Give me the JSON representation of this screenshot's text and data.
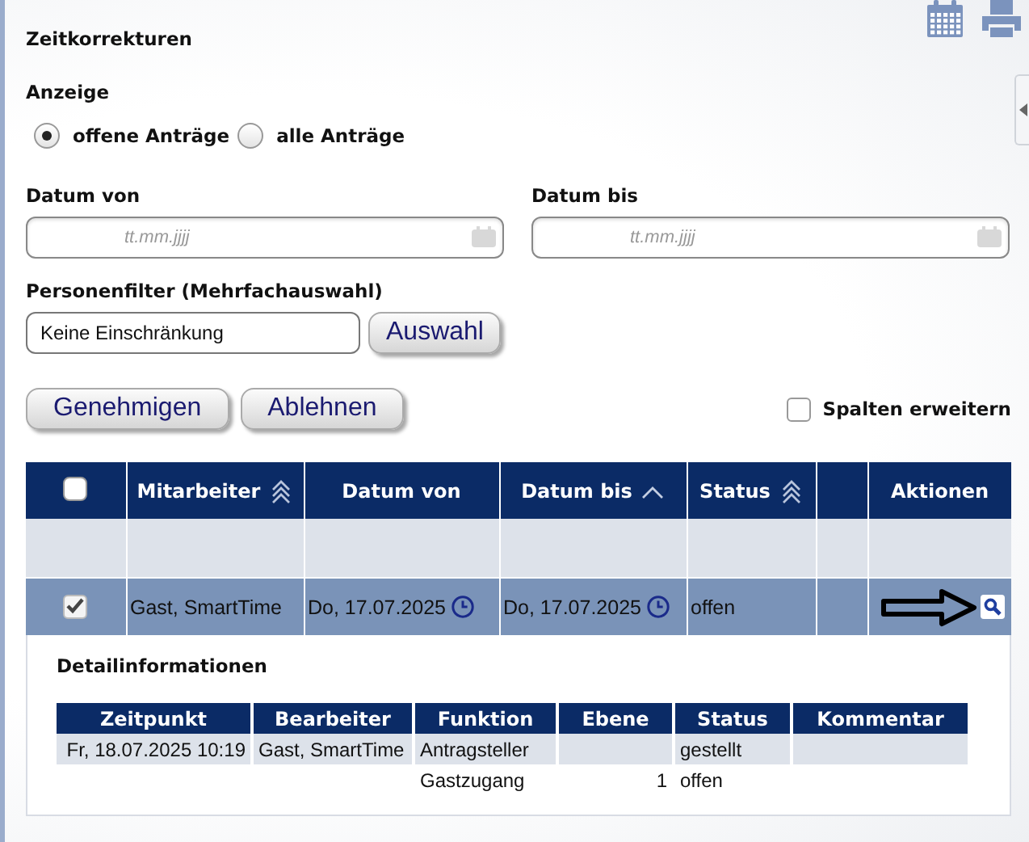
{
  "title": "Zeitkorrekturen",
  "display": {
    "label": "Anzeige",
    "options": [
      {
        "label": "offene Anträge",
        "selected": true
      },
      {
        "label": "alle Anträge",
        "selected": false
      }
    ]
  },
  "date_from": {
    "label": "Datum von",
    "placeholder": "tt.mm.jjjj"
  },
  "date_to": {
    "label": "Datum bis",
    "placeholder": "tt.mm.jjjj"
  },
  "person_filter": {
    "label": "Personenfilter (Mehrfachauswahl)",
    "value": "Keine Einschränkung",
    "button": "Auswahl"
  },
  "actions": [
    "Genehmigen",
    "Ablehnen"
  ],
  "expand_columns": {
    "label": "Spalten erweitern",
    "checked": false
  },
  "table": {
    "columns": [
      {
        "kind": "checkbox",
        "checked": false
      },
      {
        "kind": "text",
        "label": "Mitarbeiter",
        "sortable": true,
        "sorted": false
      },
      {
        "kind": "text",
        "label": "Datum von"
      },
      {
        "kind": "text",
        "label": "Datum bis",
        "sortable": true,
        "sorted": true
      },
      {
        "kind": "text",
        "label": "Status",
        "sortable": true,
        "sorted": false
      },
      {
        "kind": "blank"
      },
      {
        "kind": "text",
        "label": "Aktionen"
      }
    ],
    "rows": [
      {
        "checked": true,
        "employee": "Gast, SmartTime",
        "date_from": "Do, 17.07.2025",
        "date_to": "Do, 17.07.2025",
        "status": "offen"
      }
    ]
  },
  "detail": {
    "title": "Detailinformationen",
    "columns": [
      "Zeitpunkt",
      "Bearbeiter",
      "Funktion",
      "Ebene",
      "Status",
      "Kommentar"
    ],
    "rows": [
      {
        "time": "Fr, 18.07.2025 10:19",
        "editor": "Gast, SmartTime",
        "function": "Antragsteller",
        "status": "gestellt"
      },
      {
        "function": "Gastzugang",
        "level": "1",
        "status": "offen"
      }
    ]
  }
}
